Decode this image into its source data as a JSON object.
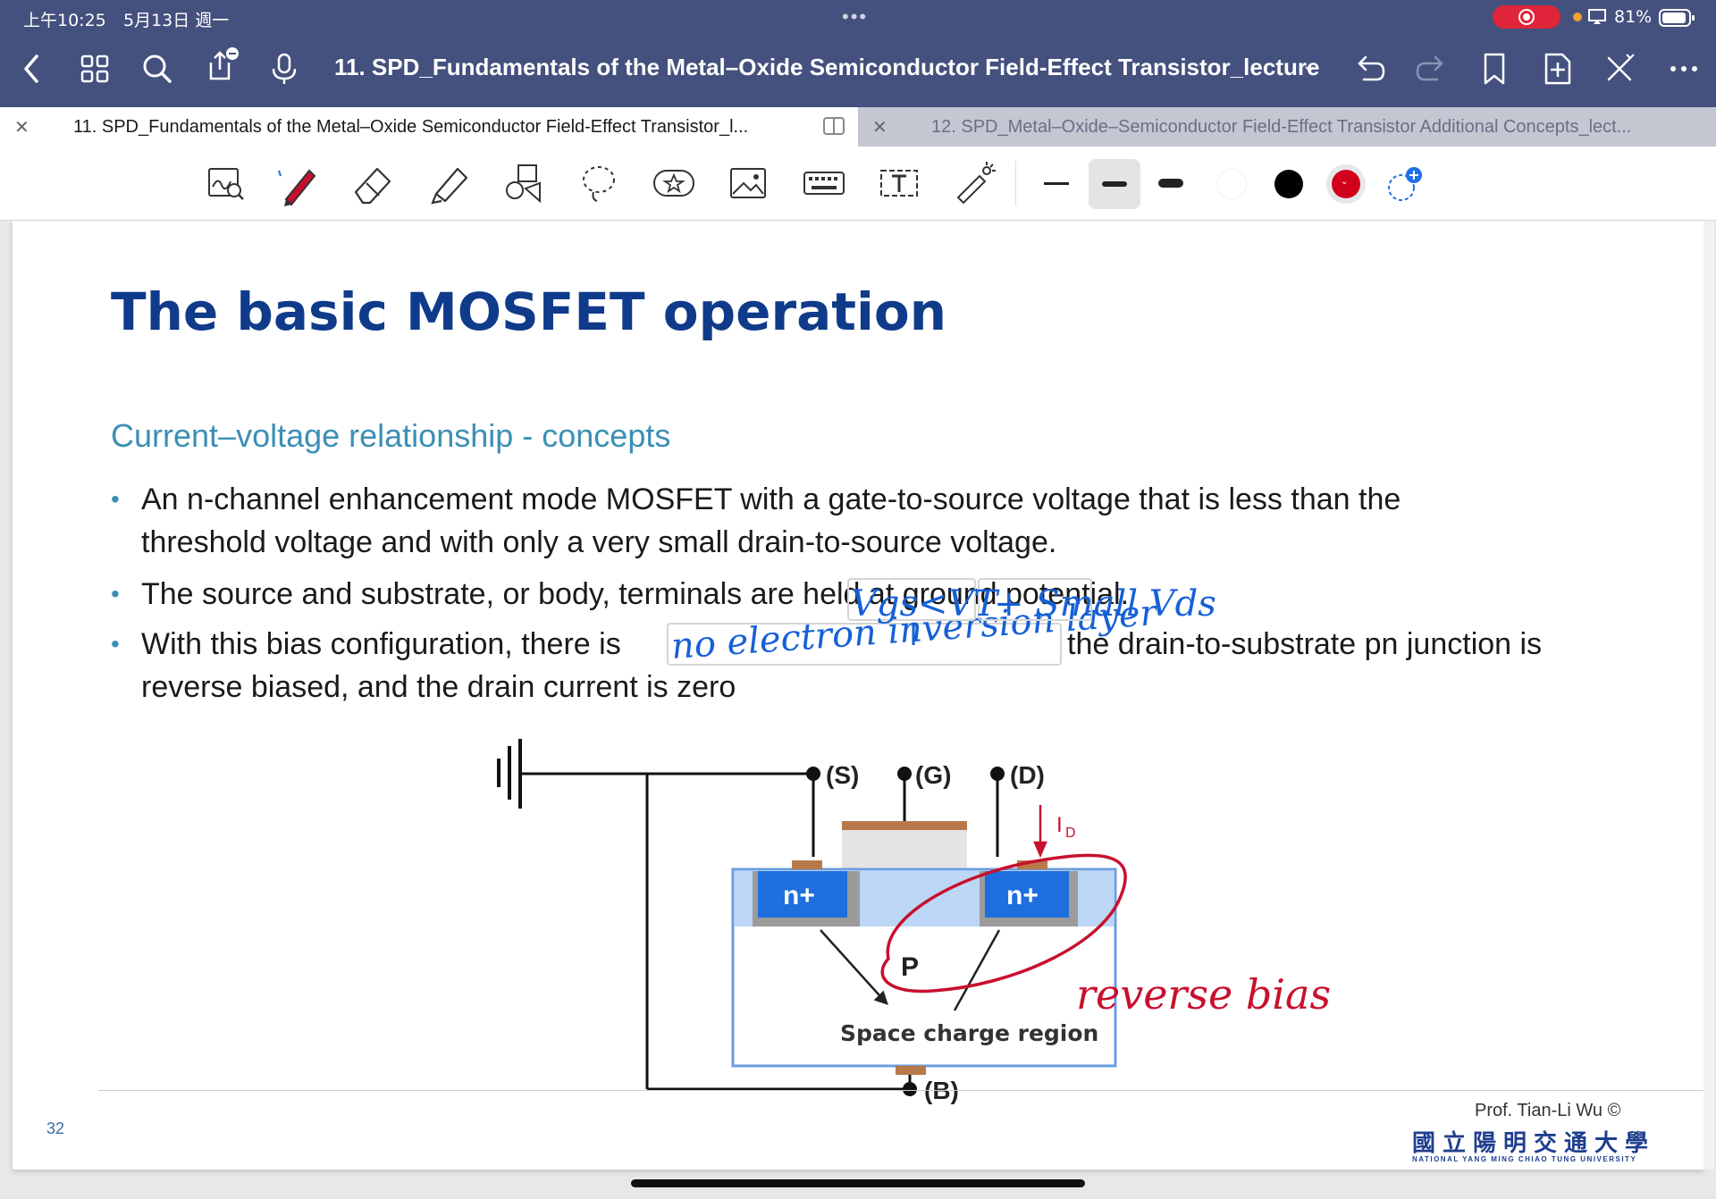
{
  "status_bar": {
    "time": "上午10:25",
    "date": "5月13日 週一",
    "battery": "81%"
  },
  "nav": {
    "doc_title": "11. SPD_Fundamentals of the Metal–Oxide Semiconductor Field-Effect Transistor_lecture",
    "title_chevron": "⌄"
  },
  "tabs": [
    {
      "label": "11. SPD_Fundamentals of the Metal–Oxide Semiconductor Field-Effect Transistor_l..."
    },
    {
      "label": "12. SPD_Metal–Oxide–Semiconductor Field-Effect Transistor Additional Concepts_lect..."
    }
  ],
  "toolbar": {
    "tools": [
      "zoom-write-icon",
      "pen-icon",
      "eraser-icon",
      "highlighter-icon",
      "shapes-icon",
      "lasso-icon",
      "sticker-icon",
      "image-icon",
      "keyboard-icon",
      "text-box-icon",
      "laser-pointer-icon"
    ],
    "stroke_widths": [
      "thin",
      "medium",
      "thick"
    ],
    "colors": {
      "white": "#ffffff",
      "black": "#000000",
      "red": "#d0021b",
      "accent": "#1f6fe5"
    }
  },
  "slide": {
    "title": "The basic MOSFET operation",
    "subtitle": "Current–voltage relationship - concepts",
    "bullets": [
      {
        "line1": "An n-channel enhancement mode MOSFET with a gate-to-source voltage that is less than the",
        "line2": "threshold voltage and with only a very small drain-to-source voltage."
      },
      {
        "line1": "The source and substrate, or body, terminals are held at ground potential.",
        "line2": ""
      },
      {
        "line1": "With this bias configuration, there is",
        "line1b": "the drain-to-substrate pn junction is",
        "line2": "reverse biased, and the drain current is zero"
      }
    ],
    "diagram": {
      "source_label": "(S)",
      "gate_label": "(G)",
      "drain_label": "(D)",
      "body_label": "(B)",
      "n_plus_left": "n+",
      "n_plus_right": "n+",
      "p_label": "P",
      "region_label": "Space charge region",
      "current_label_main": "I",
      "current_label_sub": "D"
    },
    "annotations": {
      "blank_fill": "no electron inversion layers",
      "vgs": "Vgs<VT",
      "vds": "+ Small Vds",
      "reverse_bias": "reverse bias"
    },
    "page_number": "32",
    "author": "Prof. Tian-Li Wu ©",
    "university": "國立陽明交通大學",
    "university_en": "NATIONAL YANG MING CHIAO TUNG UNIVERSITY"
  }
}
